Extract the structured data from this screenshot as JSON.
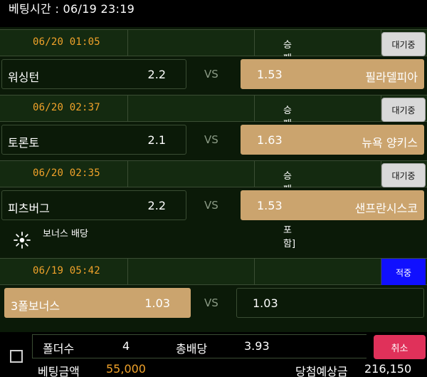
{
  "header": {
    "bet_time": "베팅시간 : 06/19 23:19"
  },
  "matches": [
    {
      "time": "06/20 01:05",
      "market": "승패 [연장포함]",
      "status": "대기중",
      "home": "워싱턴",
      "home_odds": "2.2",
      "vs": "VS",
      "away_odds": "1.53",
      "away": "필라델피아"
    },
    {
      "time": "06/20 02:37",
      "market": "승패 [연장포함]",
      "status": "대기중",
      "home": "토론토",
      "home_odds": "2.1",
      "vs": "VS",
      "away_odds": "1.63",
      "away": "뉴욕 양키스"
    },
    {
      "time": "06/20 02:35",
      "market": "승패 [연장포함]",
      "status": "대기중",
      "home": "피츠버그",
      "home_odds": "2.2",
      "vs": "VS",
      "away_odds": "1.53",
      "away": "샌프란시스코"
    }
  ],
  "bonus": {
    "label": "보너스 배당"
  },
  "bonus_match": {
    "time": "06/19 05:42",
    "status": "적중",
    "home": "3폴보너스",
    "home_odds": "1.03",
    "vs": "VS",
    "away_odds": "1.03"
  },
  "footer": {
    "folders_label": "폴더수",
    "folders_value": "4",
    "total_odds_label": "총배당",
    "total_odds_value": "3.93",
    "bet_amount_label": "베팅금액",
    "bet_amount_value": "55,000",
    "expected_label": "당첨예상금",
    "expected_value": "216,150",
    "cancel_label": "취소"
  },
  "colors": {
    "selected": "#cba46e",
    "time": "#f0a22a",
    "hit": "#1010ff",
    "cancel": "#e0315a"
  }
}
